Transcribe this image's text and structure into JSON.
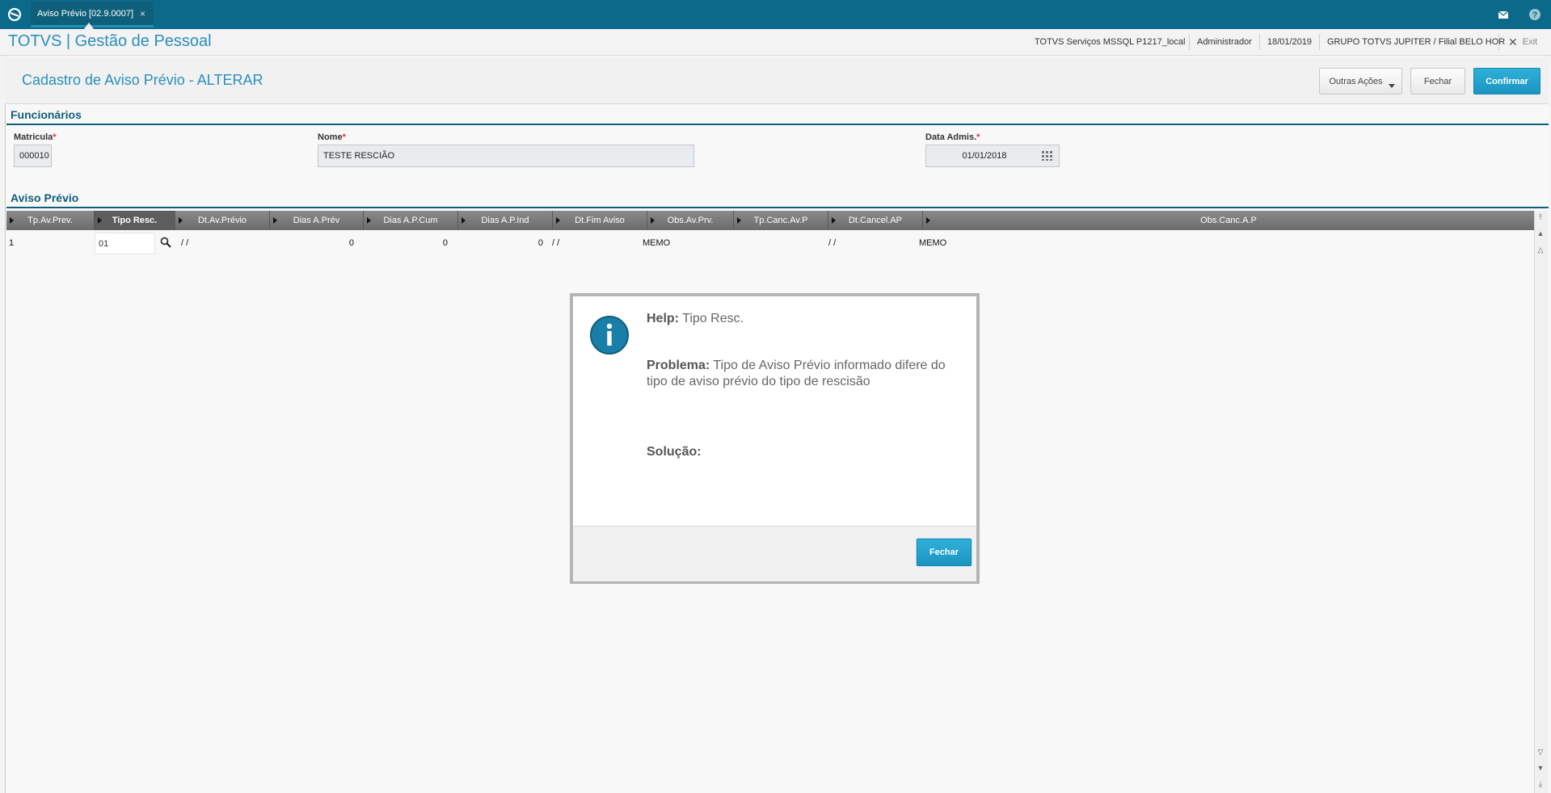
{
  "topbar": {
    "tab_label": "Aviso Prévio [02.9.0007]",
    "tab_close": "×",
    "icons": [
      "totvs-logo-icon",
      "mail-icon",
      "help-icon"
    ]
  },
  "appbar": {
    "title": "TOTVS | Gestão de Pessoal",
    "server": "TOTVS Serviços MSSQL P1217_local",
    "user": "Administrador",
    "date": "18/01/2019",
    "company": "GRUPO TOTVS JUPITER / Filial BELO HOR",
    "exit_label": "Exit"
  },
  "page": {
    "title": "Cadastro de Aviso Prévio - ALTERAR",
    "buttons": {
      "outras": "Outras Ações",
      "fechar": "Fechar",
      "confirmar": "Confirmar"
    }
  },
  "funcionarios": {
    "section_title": "Funcionários",
    "matricula_label": "Matricula",
    "matricula_value": "000010",
    "nome_label": "Nome",
    "nome_value": "TESTE RESCIÃO",
    "data_label": "Data Admis.",
    "data_value": "01/01/2018",
    "required_mark": "*"
  },
  "aviso": {
    "section_title": "Aviso Prévio",
    "columns": [
      "Tp.Av.Prev.",
      "Tipo Resc.",
      "Dt.Av.Prévio",
      "Dias A.Prév",
      "Dias A.P.Cum",
      "Dias A.P.Ind",
      "Dt.Fim Aviso",
      "Obs.Av.Prv.",
      "Tp.Canc.Av.P",
      "Dt.Cancel.AP",
      "Obs.Canc.A.P"
    ],
    "row": {
      "tp": "1",
      "tipo": "01",
      "dt_av": " / /",
      "dias_prev": "0",
      "dias_cum": "0",
      "dias_ind": "0",
      "dt_fim": " / /",
      "obs_av": "MEMO",
      "dt_cancel": " / /",
      "obs_canc": "MEMO"
    }
  },
  "dialog": {
    "help_label": "Help:",
    "help_value": "Tipo Resc.",
    "problema_label": "Problema:",
    "problema_value": "Tipo de Aviso Prévio informado difere do tipo de aviso prévio do tipo de rescisão",
    "solucao_label": "Solução:",
    "close_label": "Fechar"
  },
  "colors": {
    "topbar": "#0b6a89",
    "accent": "#2a8fbd",
    "primary_button": "#1b95c1",
    "section": "#0f5f7b"
  }
}
